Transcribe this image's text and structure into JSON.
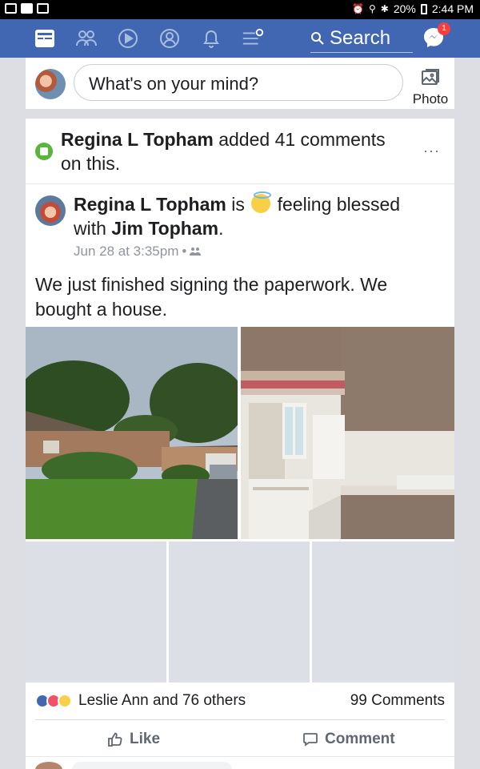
{
  "status_bar": {
    "battery": "20%",
    "time": "2:44 PM"
  },
  "nav": {
    "search_label": "Search",
    "messenger_badge": "1",
    "tabs": [
      "news-feed",
      "friends",
      "watch",
      "profile",
      "notifications",
      "menu"
    ]
  },
  "composer": {
    "placeholder": "What's on your mind?",
    "photo_label": "Photo"
  },
  "activity": {
    "actor": "Regina L Topham",
    "text": " added 41 comments on this.",
    "more": "···"
  },
  "post": {
    "author": "Regina L Topham",
    "is": " is ",
    "feeling": " feeling blessed with ",
    "tagged": "Jim Topham",
    "tail": ".",
    "date": "Jun 28 at 3:35pm",
    "body": "We just finished signing the paperwork. We bought a house.",
    "reactions_text": "Leslie Ann and 76 others",
    "comments_count": "99 Comments",
    "like_label": "Like",
    "comment_label": "Comment"
  },
  "colors": {
    "nav": "#4267b2",
    "activity_dot": "#5ab53c",
    "badge": "#fa3e3e"
  }
}
